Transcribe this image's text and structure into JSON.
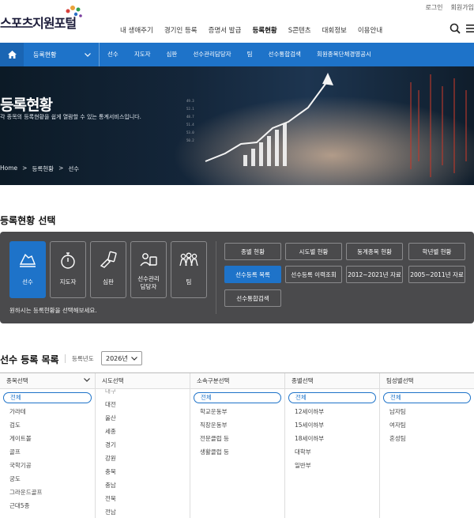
{
  "header": {
    "logo_text": "스포츠지원포털",
    "util_links": [
      "로그인",
      "회원가입"
    ],
    "nav": [
      "내 생애주기",
      "경기인 등록",
      "증명서 발급",
      "등록현황",
      "S콘텐츠",
      "대회정보",
      "이용안내"
    ],
    "nav_active_index": 3
  },
  "subbar": {
    "select_label": "등록현황",
    "links": [
      "선수",
      "지도자",
      "심판",
      "선수관리담당자",
      "팀",
      "선수통합검색",
      "회원종목단체경영공시"
    ]
  },
  "hero": {
    "title": "등록현황",
    "subtitle": "각 종목의 등록현황을 쉽게 열람할 수 있는 통계서비스입니다.",
    "breadcrumb": [
      "Home",
      ">",
      "등록현황",
      ">",
      "선수"
    ]
  },
  "selection": {
    "title": "등록현황 선택",
    "categories": [
      {
        "label": "선수",
        "icon": "runner-shoe-icon"
      },
      {
        "label": "지도자",
        "icon": "stopwatch-icon"
      },
      {
        "label": "심판",
        "icon": "whistle-card-icon"
      },
      {
        "label": "선수관리\n담당자",
        "icon": "manager-icon"
      },
      {
        "label": "팀",
        "icon": "team-icon"
      }
    ],
    "active_category": 0,
    "hint": "원하시는 등록현황을 선택해보세요.",
    "options": [
      "종별 현황",
      "시도별 현황",
      "동계종목 현황",
      "학년별 현황",
      "선수등록 목록",
      "선수등록 이력조회",
      "2012~2021년 자료",
      "2005~2011년 자료",
      "선수통합검색"
    ],
    "active_option": 4
  },
  "list": {
    "title": "선수 등록 목록",
    "year_label": "등록년도",
    "year_value": "2026년",
    "columns": [
      {
        "header": "종목선택",
        "selected": "전체",
        "items": [
          "가라테",
          "검도",
          "게이트볼",
          "골프",
          "국학기공",
          "궁도",
          "그라운드골프",
          "근대5종"
        ]
      },
      {
        "header": "시도선택",
        "selected": "",
        "items": [
          "대구",
          "대전",
          "울산",
          "세종",
          "경기",
          "강원",
          "충북",
          "충남",
          "전북",
          "전남"
        ]
      },
      {
        "header": "소속구분선택",
        "selected": "전체",
        "items": [
          "학교운동부",
          "직장운동부",
          "전문클럽 등",
          "생활클럽 등"
        ]
      },
      {
        "header": "종별선택",
        "selected": "전체",
        "items": [
          "12세이하부",
          "15세이하부",
          "18세이하부",
          "대학부",
          "일반부"
        ]
      },
      {
        "header": "팀성별선택",
        "selected": "전체",
        "items": [
          "남자팀",
          "여자팀",
          "혼성팀"
        ]
      }
    ]
  },
  "colors": {
    "brand_blue": "#1e73c9",
    "panel_dark": "#4a4a4c"
  }
}
